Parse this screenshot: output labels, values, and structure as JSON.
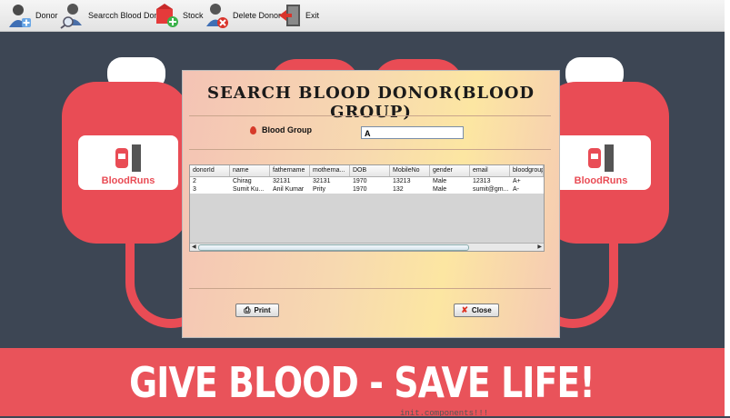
{
  "toolbar": {
    "items": [
      {
        "label": "Donor",
        "icon": "person-add-icon"
      },
      {
        "label": "Searcch Blood Donor",
        "icon": "search-user-icon"
      },
      {
        "label": "Stock",
        "icon": "stock-icon"
      },
      {
        "label": "Delete Donor",
        "icon": "delete-user-icon"
      },
      {
        "label": "Exit",
        "icon": "exit-door-icon"
      }
    ]
  },
  "background": {
    "banner_text": "GIVE BLOOD - SAVE LIFE!",
    "bag_brand": "BloodRuns",
    "code_fragment": "init.components!!!"
  },
  "dialog": {
    "title": "SEARCH BLOOD DONOR(BLOOD GROUP)",
    "blood_group_label": "Blood Group",
    "blood_group_value": "A",
    "table": {
      "columns": [
        "donorId",
        "name",
        "fathername",
        "motherna...",
        "DOB",
        "MobileNo",
        "gender",
        "email",
        "bloodgroup"
      ],
      "rows": [
        [
          "2",
          "Chirag",
          "32131",
          "32131",
          "1970",
          "13213",
          "Male",
          "12313",
          "A+"
        ],
        [
          "3",
          "Sumit Ku...",
          "Anil Kumar",
          "Prity",
          "1970",
          "132",
          "Male",
          "sumit@gm...",
          "A-"
        ]
      ]
    },
    "print_label": "Print",
    "close_label": "Close"
  },
  "colors": {
    "banner": "#e9535a",
    "background": "#3d4654",
    "bag": "#e94c55"
  }
}
